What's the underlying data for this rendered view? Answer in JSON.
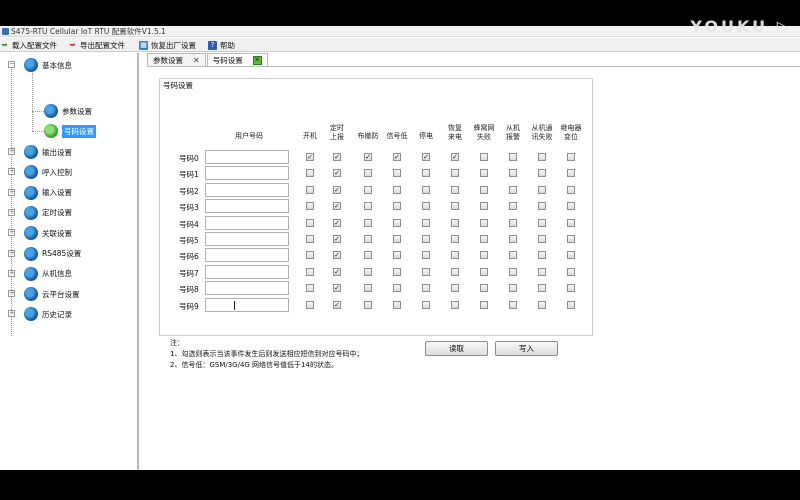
{
  "window": {
    "title": "S475-RTU Cellular IoT RTU 配置软件V1.5.1"
  },
  "toolbar": {
    "items": [
      {
        "label": "载入配置文件",
        "icon": "import-arrow-icon"
      },
      {
        "label": "导出配置文件",
        "icon": "export-arrow-icon"
      },
      {
        "label": "恢复出厂设置",
        "icon": "restore-icon"
      },
      {
        "label": "帮助",
        "icon": "help-icon"
      }
    ]
  },
  "watermark": {
    "text": "YOUKU ▷"
  },
  "tree": {
    "root": {
      "label": "基本信息",
      "expander": "－"
    },
    "children": [
      {
        "label": "参数设置"
      },
      {
        "label": "号码设置",
        "selected": true
      }
    ],
    "nodes": [
      {
        "label": "输出设置",
        "expander": "＋"
      },
      {
        "label": "呼入控制",
        "expander": "＋"
      },
      {
        "label": "输入设置",
        "expander": "＋"
      },
      {
        "label": "定时设置",
        "expander": "＋"
      },
      {
        "label": "关联设置",
        "expander": "＋"
      },
      {
        "label": "RS485设置",
        "expander": "＋"
      },
      {
        "label": "从机信息",
        "expander": "＋"
      },
      {
        "label": "云平台设置",
        "expander": "＋"
      },
      {
        "label": "历史记录",
        "expander": "＋"
      }
    ]
  },
  "tabs": [
    {
      "label": "参数设置",
      "close": "✕"
    },
    {
      "label": "号码设置",
      "close": "✕",
      "active": true
    }
  ],
  "number_settings": {
    "group_title": "号码设置",
    "input_header": "用户号码",
    "columns": [
      "开机",
      "定时\n上报",
      "布撤防",
      "信号低",
      "停电",
      "恢复\n来电",
      "蜂窝网\n失败",
      "从机\n报警",
      "从机通\n讯失败",
      "继电器\n变位"
    ],
    "rows": [
      {
        "label": "号码0",
        "value": "",
        "checks": [
          true,
          true,
          true,
          true,
          true,
          true,
          false,
          false,
          false,
          false
        ]
      },
      {
        "label": "号码1",
        "value": "",
        "checks": [
          false,
          true,
          false,
          false,
          false,
          false,
          false,
          false,
          false,
          false
        ]
      },
      {
        "label": "号码2",
        "value": "",
        "checks": [
          false,
          true,
          false,
          false,
          false,
          false,
          false,
          false,
          false,
          false
        ]
      },
      {
        "label": "号码3",
        "value": "",
        "checks": [
          false,
          true,
          false,
          false,
          false,
          false,
          false,
          false,
          false,
          false
        ]
      },
      {
        "label": "号码4",
        "value": "",
        "checks": [
          false,
          true,
          false,
          false,
          false,
          false,
          false,
          false,
          false,
          false
        ]
      },
      {
        "label": "号码5",
        "value": "",
        "checks": [
          false,
          true,
          false,
          false,
          false,
          false,
          false,
          false,
          false,
          false
        ]
      },
      {
        "label": "号码6",
        "value": "",
        "checks": [
          false,
          true,
          false,
          false,
          false,
          false,
          false,
          false,
          false,
          false
        ]
      },
      {
        "label": "号码7",
        "value": "",
        "checks": [
          false,
          true,
          false,
          false,
          false,
          false,
          false,
          false,
          false,
          false
        ]
      },
      {
        "label": "号码8",
        "value": "",
        "checks": [
          false,
          true,
          false,
          false,
          false,
          false,
          false,
          false,
          false,
          false
        ]
      },
      {
        "label": "号码9",
        "value": "",
        "checks": [
          false,
          true,
          false,
          false,
          false,
          false,
          false,
          false,
          false,
          false
        ]
      }
    ],
    "check_mark": "✓"
  },
  "notes": {
    "title": "注：",
    "lines": [
      "1、勾选则表示当该事件发生后则发送相应短信到对应号码中；",
      "2、信号低：GSM/3G/4G 网络信号值低于14的状态。"
    ]
  },
  "buttons": {
    "read": "读取",
    "write": "写入"
  }
}
